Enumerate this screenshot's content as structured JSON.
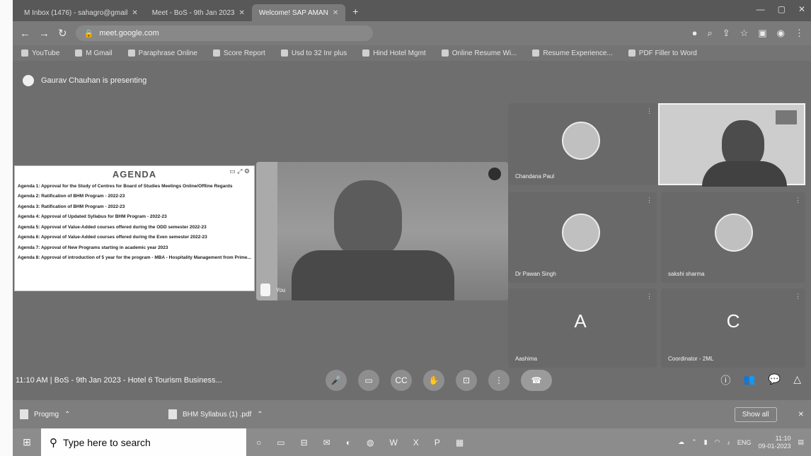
{
  "browser": {
    "tabs": [
      {
        "label": "M Inbox (1476) - sahagro@gmail",
        "active": false
      },
      {
        "label": "Meet - BoS - 9th Jan 2023",
        "active": false
      },
      {
        "label": "Welcome! SAP AMAN",
        "active": true
      }
    ],
    "url": "meet.google.com",
    "bookmarks": [
      "YouTube",
      "M Gmail",
      "Paraphrase Online",
      "Score Report",
      "Usd to 32 Inr plus",
      "Hind Hotel Mgmt",
      "Online Resume Wi...",
      "Resume Experience...",
      "PDF Filler to Word"
    ]
  },
  "meet": {
    "presenting_text": "Gaurav Chauhan is presenting",
    "agenda": {
      "title": "AGENDA",
      "items": [
        "Agenda 1: Approval for the Study of Centres for Board of Studies Meetings Online/Offline Regards",
        "Agenda 2: Ratification of BHM Program - 2022-23",
        "Agenda 3: Ratification of BHM Program - 2022-23",
        "Agenda 4: Approval of Updated Syllabus for BHM Program - 2022-23",
        "Agenda 5: Approval of Value-Added courses offered during the ODD semester 2022-23",
        "Agenda 6: Approval of Value-Added courses offered during the Even semester 2022-23",
        "Agenda 7: Approval of New Programs starting in academic year 2023",
        "Agenda 8: Approval of introduction of 5 year for the program - MBA - Hospitality Management from Prime..."
      ]
    },
    "participants": [
      {
        "name": "Chandana Paul",
        "type": "avatar"
      },
      {
        "name": "Dr Pawan Singh",
        "type": "avatar"
      },
      {
        "name": "sakshi sharma",
        "type": "avatar"
      },
      {
        "name": "Aashima",
        "type": "letter",
        "letter": "A"
      },
      {
        "name": "Coordinator - 2ML",
        "type": "letter",
        "letter": "C"
      }
    ],
    "speaker_name": "You",
    "meeting_info": "11:10 AM | BoS - 9th Jan 2023 - Hotel 6 Tourism Business..."
  },
  "downloads": [
    {
      "name": "Progmg"
    },
    {
      "name": "BHM Syllabus (1) .pdf"
    }
  ],
  "downloads_show_all": "Show all",
  "taskbar": {
    "search_placeholder": "Type here to search",
    "time": "11:10",
    "date": "09-01-2023",
    "lang": "ENG"
  }
}
